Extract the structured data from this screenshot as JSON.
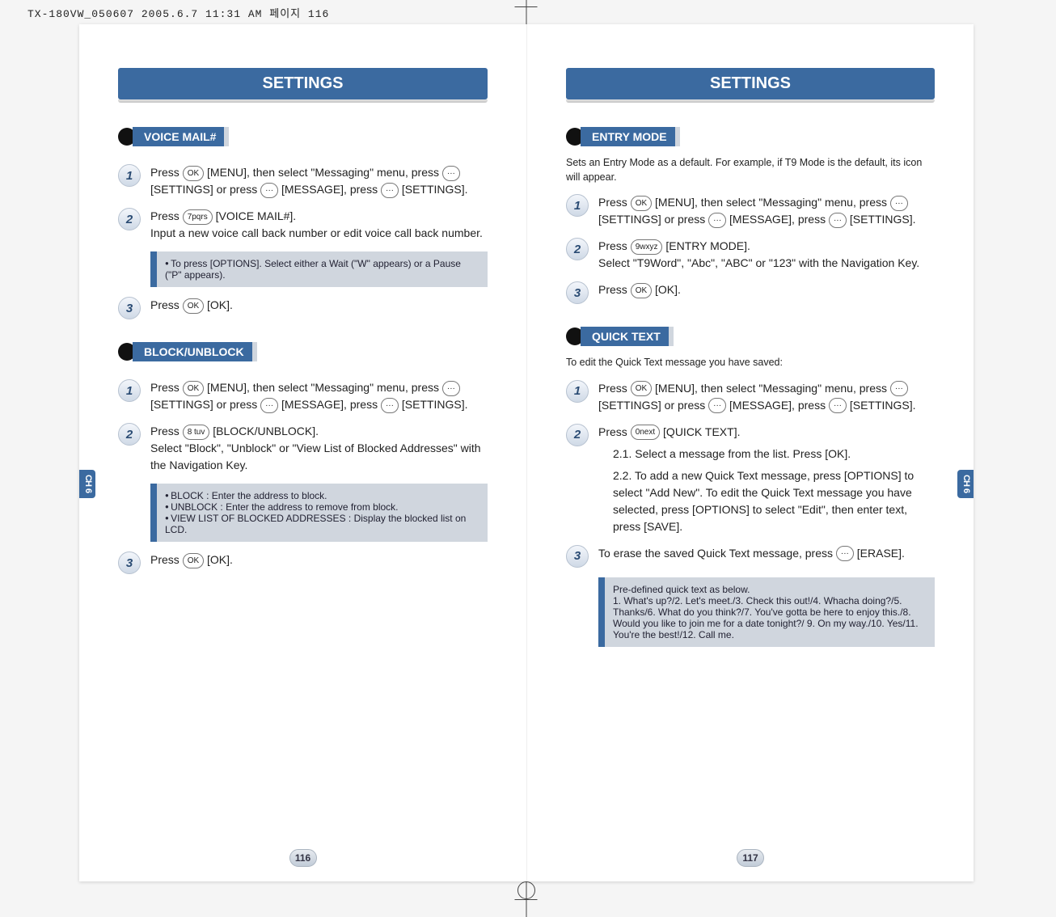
{
  "print_header": "TX-180VW_050607  2005.6.7 11:31 AM  페이지 116",
  "left": {
    "header": "SETTINGS",
    "side_tab": {
      "ch": "CH",
      "num": "6"
    },
    "page_number": "116",
    "voice_mail": {
      "title": "VOICE MAIL#",
      "steps": [
        {
          "num": "1",
          "text_parts": [
            "Press ",
            " [MENU], then select \"Messaging\" menu, press ",
            " [SETTINGS] or press ",
            " [MESSAGE], press ",
            " [SETTINGS]."
          ],
          "keys": [
            "OK",
            "···",
            "···",
            "···"
          ]
        },
        {
          "num": "2",
          "text_parts": [
            "Press ",
            " [VOICE MAIL#].",
            " Input a new voice call back number or edit voice call back number."
          ],
          "keys": [
            "7pqrs"
          ]
        },
        {
          "num": "3",
          "text_parts": [
            "Press ",
            " [OK]."
          ],
          "keys": [
            "OK"
          ]
        }
      ],
      "note": "To press        [OPTIONS]. Select either a Wait (\"W\" appears) or a Pause (\"P\" appears)."
    },
    "block_unblock": {
      "title": "BLOCK/UNBLOCK",
      "steps": [
        {
          "num": "1",
          "text_parts": [
            "Press ",
            " [MENU], then select \"Messaging\" menu, press ",
            " [SETTINGS] or press ",
            " [MESSAGE], press ",
            " [SETTINGS]."
          ],
          "keys": [
            "OK",
            "···",
            "···",
            "···"
          ]
        },
        {
          "num": "2",
          "text_parts": [
            "Press ",
            " [BLOCK/UNBLOCK].",
            " Select \"Block\", \"Unblock\" or \"View List of Blocked Addresses\" with the Navigation Key."
          ],
          "keys": [
            "8 tuv"
          ]
        },
        {
          "num": "3",
          "text_parts": [
            "Press ",
            " [OK]."
          ],
          "keys": [
            "OK"
          ]
        }
      ],
      "notes": [
        "BLOCK : Enter the address to block.",
        "UNBLOCK : Enter the address to remove from block.",
        "VIEW LIST OF BLOCKED ADDRESSES : Display the blocked list on LCD."
      ]
    }
  },
  "right": {
    "header": "SETTINGS",
    "side_tab": {
      "ch": "CH",
      "num": "6"
    },
    "page_number": "117",
    "entry_mode": {
      "title": "ENTRY MODE",
      "intro": "Sets an Entry Mode as a default. For example, if T9 Mode is the default, its icon will appear.",
      "steps": [
        {
          "num": "1",
          "text_parts": [
            "Press ",
            " [MENU], then select \"Messaging\" menu, press ",
            " [SETTINGS] or press ",
            " [MESSAGE], press ",
            " [SETTINGS]."
          ],
          "keys": [
            "OK",
            "···",
            "···",
            "···"
          ]
        },
        {
          "num": "2",
          "text_parts": [
            "Press ",
            " [ENTRY MODE].",
            " Select \"T9Word\", \"Abc\", \"ABC\" or \"123\" with the Navigation Key."
          ],
          "keys": [
            "9wxyz"
          ]
        },
        {
          "num": "3",
          "text_parts": [
            "Press ",
            " [OK]."
          ],
          "keys": [
            "OK"
          ]
        }
      ]
    },
    "quick_text": {
      "title": "QUICK TEXT",
      "intro": "To edit the Quick Text message you have saved:",
      "steps": [
        {
          "num": "1",
          "text_parts": [
            "Press ",
            " [MENU], then select \"Messaging\" menu, press ",
            " [SETTINGS] or press ",
            " [MESSAGE], press ",
            " [SETTINGS]."
          ],
          "keys": [
            "OK",
            "···",
            "···",
            "···"
          ]
        },
        {
          "num": "2",
          "text_parts": [
            "Press ",
            " [QUICK TEXT]."
          ],
          "keys": [
            "0next"
          ]
        },
        {
          "num": "3",
          "text_parts": [
            "To erase the saved Quick Text message, press ",
            " [ERASE]."
          ],
          "keys": [
            "···"
          ]
        }
      ],
      "substeps": [
        "2.1. Select a message from the list. Press      [OK].",
        "2.2. To add a new Quick Text message, press        [OPTIONS] to select \"Add New\". To edit the Quick Text message you have selected, press        [OPTIONS] to select \"Edit\", then enter text, press      [SAVE]."
      ],
      "note_title": "Pre-defined quick text as below.",
      "note_body": "1. What's up?/2. Let's meet./3. Check this out!/4. Whacha doing?/5. Thanks/6. What do you think?/7. You've gotta be here to enjoy this./8. Would you like to join me for a date tonight?/ 9. On my way./10. Yes/11. You're the best!/12. Call me."
    }
  }
}
